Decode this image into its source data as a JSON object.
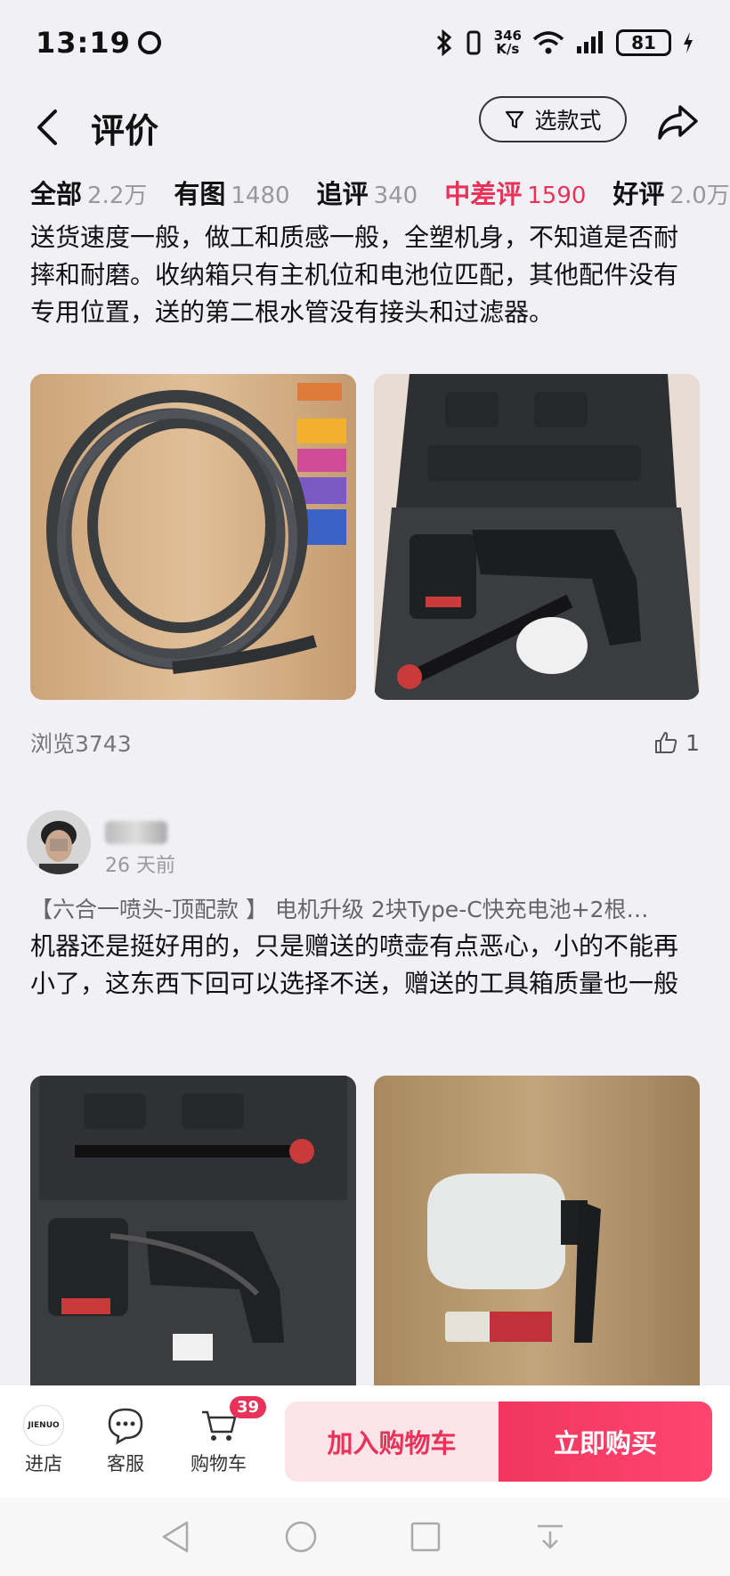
{
  "status_bar": {
    "time": "13:19",
    "speed_value": "346",
    "speed_unit": "K/s",
    "battery": "81"
  },
  "header": {
    "title": "评价",
    "filter_label": "选款式"
  },
  "tabs": [
    {
      "label": "全部",
      "count": "2.2万"
    },
    {
      "label": "有图",
      "count": "1480"
    },
    {
      "label": "追评",
      "count": "340"
    },
    {
      "label": "中差评",
      "count": "1590"
    },
    {
      "label": "好评",
      "count": "2.0万"
    }
  ],
  "reviews": [
    {
      "text": "送货速度一般，做工和质感一般，全塑机身，不知道是否耐摔和耐磨。收纳箱只有主机位和电池位匹配，其他配件没有专用位置，送的第二根水管没有接头和过滤器。",
      "views": "浏览3743",
      "likes": "1"
    },
    {
      "date": "26 天前",
      "sku": "【六合一喷头-顶配款 】 电机升级 2块Type-C快充电池+2根…",
      "text": "机器还是挺好用的，只是赠送的喷壶有点恶心，小的不能再小了，这东西下回可以选择不送，赠送的工具箱质量也一般"
    }
  ],
  "bottom_bar": {
    "shop_label": "进店",
    "shop_logo_text": "JIENUO",
    "service_label": "客服",
    "cart_label": "购物车",
    "cart_count": "39",
    "add_cart": "加入购物车",
    "buy_now": "立即购买"
  },
  "colors": {
    "accent": "#e8325a",
    "background": "#f1f1f5"
  }
}
